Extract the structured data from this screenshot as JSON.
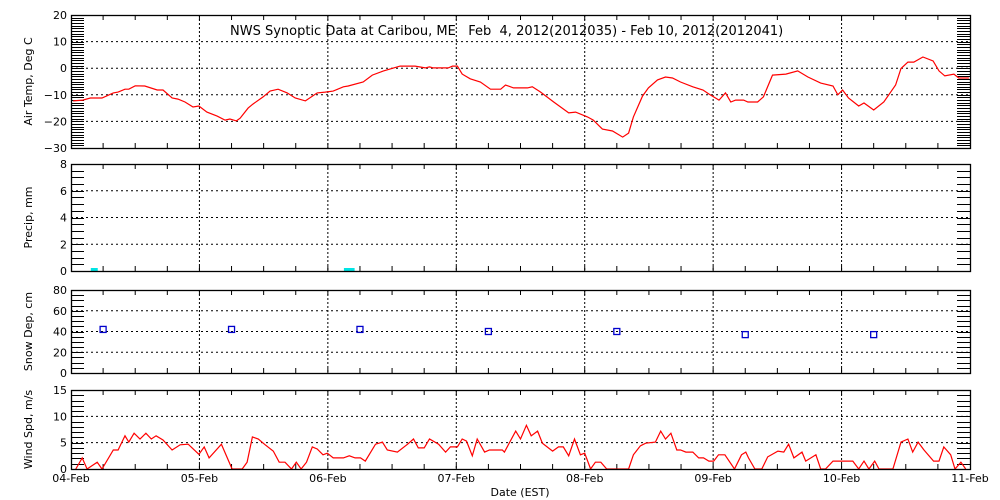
{
  "chart_data": {
    "type": "line",
    "title": "NWS Synoptic Data at Caribou, ME   Feb  4, 2012(2012035) - Feb 10, 2012(2012041)",
    "xlabel": "Date (EST)",
    "x_units": "hours since 04-Feb 00:00",
    "xlim": [
      0,
      168
    ],
    "x_ticks": [
      "04-Feb",
      "05-Feb",
      "06-Feb",
      "07-Feb",
      "08-Feb",
      "09-Feb",
      "10-Feb",
      "11-Feb"
    ],
    "grid": true,
    "panels": [
      {
        "name": "air-temp",
        "ylabel": "Air Temp, Deg C",
        "ylim": [
          -30,
          20
        ],
        "y_ticks": [
          -30,
          -20,
          -10,
          0,
          10,
          20
        ],
        "minor_step": 1,
        "kind": "line",
        "color": "#ff0000",
        "points": [
          [
            0.4,
            -12.3
          ],
          [
            2.2,
            -12
          ],
          [
            3.6,
            -11.2
          ],
          [
            5.8,
            -11.2
          ],
          [
            7.9,
            -9.3
          ],
          [
            8.8,
            -9
          ],
          [
            10.1,
            -7.9
          ],
          [
            10.8,
            -7.9
          ],
          [
            12.0,
            -6.6
          ],
          [
            13.8,
            -6.7
          ],
          [
            16.1,
            -8.2
          ],
          [
            17.2,
            -8.2
          ],
          [
            18.9,
            -11.2
          ],
          [
            20.0,
            -11.6
          ],
          [
            21.3,
            -12.7
          ],
          [
            22.8,
            -14.6
          ],
          [
            23.9,
            -14.2
          ],
          [
            25.4,
            -16.5
          ],
          [
            27.3,
            -18
          ],
          [
            28.8,
            -19.5
          ],
          [
            29.7,
            -19.1
          ],
          [
            30.9,
            -19.8
          ],
          [
            31.6,
            -18.8
          ],
          [
            33.1,
            -15
          ],
          [
            34.0,
            -13.5
          ],
          [
            35.9,
            -10.8
          ],
          [
            37.2,
            -8.6
          ],
          [
            38.7,
            -7.9
          ],
          [
            40.4,
            -9.3
          ],
          [
            41.9,
            -11.2
          ],
          [
            43.8,
            -12.3
          ],
          [
            46.0,
            -9.3
          ],
          [
            47.5,
            -9
          ],
          [
            49.0,
            -8.6
          ],
          [
            50.9,
            -7
          ],
          [
            51.8,
            -6.7
          ],
          [
            54.6,
            -5.2
          ],
          [
            56.3,
            -2.6
          ],
          [
            58.4,
            -1
          ],
          [
            61.5,
            0.8
          ],
          [
            64.3,
            0.8
          ],
          [
            66.2,
            0.1
          ],
          [
            67.0,
            0.5
          ],
          [
            67.7,
            0.1
          ],
          [
            70.5,
            0.1
          ],
          [
            71.3,
            0.8
          ],
          [
            72.2,
            0.8
          ],
          [
            73.1,
            -2.2
          ],
          [
            74.6,
            -4
          ],
          [
            76.5,
            -5.2
          ],
          [
            78.4,
            -7.9
          ],
          [
            80.3,
            -7.9
          ],
          [
            81.2,
            -6.3
          ],
          [
            82.7,
            -7.4
          ],
          [
            85.3,
            -7.4
          ],
          [
            86.2,
            -7
          ],
          [
            87.7,
            -8.9
          ],
          [
            90.2,
            -12.7
          ],
          [
            91.5,
            -14.6
          ],
          [
            93.0,
            -16.8
          ],
          [
            94.3,
            -16.5
          ],
          [
            96.5,
            -18.3
          ],
          [
            97.6,
            -19.5
          ],
          [
            99.3,
            -22.9
          ],
          [
            101.2,
            -23.6
          ],
          [
            103.1,
            -25.9
          ],
          [
            104.2,
            -24.4
          ],
          [
            105.1,
            -18.3
          ],
          [
            106.8,
            -10.5
          ],
          [
            107.9,
            -7.4
          ],
          [
            109.6,
            -4.4
          ],
          [
            111.1,
            -3.3
          ],
          [
            112.4,
            -3.7
          ],
          [
            113.9,
            -5.2
          ],
          [
            116.2,
            -7
          ],
          [
            118.1,
            -8.2
          ],
          [
            119.2,
            -9.7
          ],
          [
            121.1,
            -12
          ],
          [
            122.3,
            -9.3
          ],
          [
            123.3,
            -12.7
          ],
          [
            124.2,
            -12
          ],
          [
            125.7,
            -12
          ],
          [
            126.5,
            -12.7
          ],
          [
            128.3,
            -12.7
          ],
          [
            129.4,
            -10.8
          ],
          [
            131.1,
            -2.6
          ],
          [
            133.6,
            -2.2
          ],
          [
            135.8,
            -1
          ],
          [
            137.7,
            -3.3
          ],
          [
            140.1,
            -5.6
          ],
          [
            142.4,
            -6.7
          ],
          [
            143.3,
            -10
          ],
          [
            144.2,
            -8.2
          ],
          [
            145.3,
            -11.2
          ],
          [
            147.2,
            -14.2
          ],
          [
            148.2,
            -13.1
          ],
          [
            150.0,
            -15.7
          ],
          [
            151.9,
            -12.7
          ],
          [
            154.1,
            -6.3
          ],
          [
            155.1,
            -0.1
          ],
          [
            156.4,
            2.3
          ],
          [
            157.5,
            2.3
          ],
          [
            159.2,
            4.2
          ],
          [
            161.1,
            2.7
          ],
          [
            162.2,
            -1
          ],
          [
            163.3,
            -2.9
          ],
          [
            165.0,
            -2.2
          ],
          [
            165.9,
            -3.7
          ],
          [
            167.8,
            -3.7
          ]
        ]
      },
      {
        "name": "precip",
        "ylabel": "Precip, mm",
        "ylim": [
          0,
          8
        ],
        "y_ticks": [
          0,
          2,
          4,
          6,
          8
        ],
        "minor_step": 0.5,
        "kind": "bar",
        "color": "#00e5e5",
        "bars": [
          [
            3.7,
            5.0,
            0.1
          ],
          [
            51.0,
            53.0,
            0.1
          ]
        ]
      },
      {
        "name": "snow-depth",
        "ylabel": "Snow Dep, cm",
        "ylim": [
          0,
          80
        ],
        "y_ticks": [
          0,
          20,
          40,
          60,
          80
        ],
        "minor_step": 5,
        "kind": "scatter",
        "color": "#0000cc",
        "points": [
          [
            6,
            42
          ],
          [
            30,
            42
          ],
          [
            54,
            42
          ],
          [
            78,
            40
          ],
          [
            102,
            40
          ],
          [
            126,
            37
          ],
          [
            150,
            37
          ]
        ]
      },
      {
        "name": "wind-speed",
        "ylabel": "Wind Spd, m/s",
        "ylim": [
          0,
          15
        ],
        "y_ticks": [
          0,
          5,
          10,
          15
        ],
        "minor_step": 1,
        "kind": "line",
        "color": "#ff0000",
        "points": [
          [
            0.9,
            0
          ],
          [
            2.1,
            2.1
          ],
          [
            3.0,
            0
          ],
          [
            4.9,
            1.3
          ],
          [
            5.8,
            0
          ],
          [
            7.9,
            3.6
          ],
          [
            8.8,
            3.6
          ],
          [
            10.1,
            6.3
          ],
          [
            10.8,
            5.1
          ],
          [
            11.8,
            6.8
          ],
          [
            12.9,
            5.7
          ],
          [
            14.0,
            6.8
          ],
          [
            15.0,
            5.7
          ],
          [
            15.9,
            6.3
          ],
          [
            17.2,
            5.5
          ],
          [
            18.9,
            3.6
          ],
          [
            20.4,
            4.6
          ],
          [
            21.9,
            4.7
          ],
          [
            23.9,
            2.8
          ],
          [
            24.9,
            4.2
          ],
          [
            25.8,
            2.1
          ],
          [
            28.1,
            4.7
          ],
          [
            30.1,
            0
          ],
          [
            32.0,
            0
          ],
          [
            32.9,
            1.3
          ],
          [
            33.9,
            6.1
          ],
          [
            35.0,
            5.7
          ],
          [
            36.3,
            4.6
          ],
          [
            37.8,
            3.4
          ],
          [
            38.9,
            1.3
          ],
          [
            40.0,
            1.3
          ],
          [
            41.2,
            0
          ],
          [
            42.1,
            1.3
          ],
          [
            43.0,
            0
          ],
          [
            44.0,
            1.3
          ],
          [
            45.1,
            4.2
          ],
          [
            46.0,
            3.8
          ],
          [
            47.1,
            2.7
          ],
          [
            47.9,
            3.0
          ],
          [
            49.0,
            2.1
          ],
          [
            50.9,
            2.1
          ],
          [
            52.0,
            2.5
          ],
          [
            53.1,
            2.1
          ],
          [
            54.1,
            2.1
          ],
          [
            55.0,
            1.5
          ],
          [
            56.9,
            4.7
          ],
          [
            58.2,
            5.1
          ],
          [
            59.1,
            3.6
          ],
          [
            61.0,
            3.2
          ],
          [
            62.9,
            4.7
          ],
          [
            64.0,
            5.7
          ],
          [
            64.9,
            4.0
          ],
          [
            66.0,
            4.0
          ],
          [
            67.0,
            5.7
          ],
          [
            68.7,
            4.7
          ],
          [
            70.0,
            3.2
          ],
          [
            70.9,
            4.2
          ],
          [
            72.2,
            4.2
          ],
          [
            73.1,
            5.7
          ],
          [
            73.9,
            5.3
          ],
          [
            75.0,
            2.5
          ],
          [
            75.9,
            5.7
          ],
          [
            77.3,
            3.2
          ],
          [
            78.2,
            3.6
          ],
          [
            80.6,
            3.6
          ],
          [
            81.0,
            3.2
          ],
          [
            83.1,
            7.2
          ],
          [
            84.0,
            5.7
          ],
          [
            85.1,
            8.3
          ],
          [
            86.0,
            6.3
          ],
          [
            87.2,
            7.2
          ],
          [
            88.1,
            4.9
          ],
          [
            90.0,
            3.4
          ],
          [
            91.1,
            4.2
          ],
          [
            92.0,
            4.2
          ],
          [
            93.0,
            2.5
          ],
          [
            94.1,
            5.7
          ],
          [
            95.2,
            2.7
          ],
          [
            96.0,
            3.0
          ],
          [
            97.1,
            0
          ],
          [
            98.0,
            1.3
          ],
          [
            99.0,
            1.3
          ],
          [
            100.1,
            0
          ],
          [
            104.2,
            0
          ],
          [
            105.1,
            2.7
          ],
          [
            106.4,
            4.4
          ],
          [
            107.4,
            4.9
          ],
          [
            109.2,
            5.1
          ],
          [
            110.2,
            7.2
          ],
          [
            111.1,
            5.7
          ],
          [
            112.1,
            6.8
          ],
          [
            113.2,
            3.6
          ],
          [
            113.9,
            3.6
          ],
          [
            114.9,
            3.2
          ],
          [
            116.2,
            3.2
          ],
          [
            117.3,
            2.1
          ],
          [
            118.2,
            2.1
          ],
          [
            119.2,
            1.5
          ],
          [
            120.1,
            1.5
          ],
          [
            121.0,
            2.7
          ],
          [
            122.2,
            2.7
          ],
          [
            124.0,
            0
          ],
          [
            125.3,
            2.7
          ],
          [
            126.1,
            3.2
          ],
          [
            126.6,
            2.1
          ],
          [
            127.8,
            0
          ],
          [
            129.1,
            0
          ],
          [
            130.2,
            2.3
          ],
          [
            132.1,
            3.4
          ],
          [
            133.2,
            3.2
          ],
          [
            134.1,
            4.7
          ],
          [
            135.1,
            2.1
          ],
          [
            136.6,
            3.2
          ],
          [
            137.3,
            1.5
          ],
          [
            139.2,
            2.7
          ],
          [
            140.1,
            0
          ],
          [
            141.0,
            0
          ],
          [
            142.4,
            1.5
          ],
          [
            146.1,
            1.5
          ],
          [
            147.2,
            0
          ],
          [
            148.2,
            1.5
          ],
          [
            149.1,
            0
          ],
          [
            150.2,
            1.5
          ],
          [
            151.0,
            0
          ],
          [
            153.6,
            0
          ],
          [
            155.1,
            5.1
          ],
          [
            156.4,
            5.7
          ],
          [
            157.3,
            3.2
          ],
          [
            158.3,
            5.1
          ],
          [
            159.4,
            3.6
          ],
          [
            161.2,
            1.5
          ],
          [
            162.2,
            1.5
          ],
          [
            163.1,
            4.2
          ],
          [
            164.4,
            2.7
          ],
          [
            165.2,
            0
          ],
          [
            166.3,
            1.3
          ],
          [
            167.2,
            0
          ]
        ]
      }
    ]
  }
}
